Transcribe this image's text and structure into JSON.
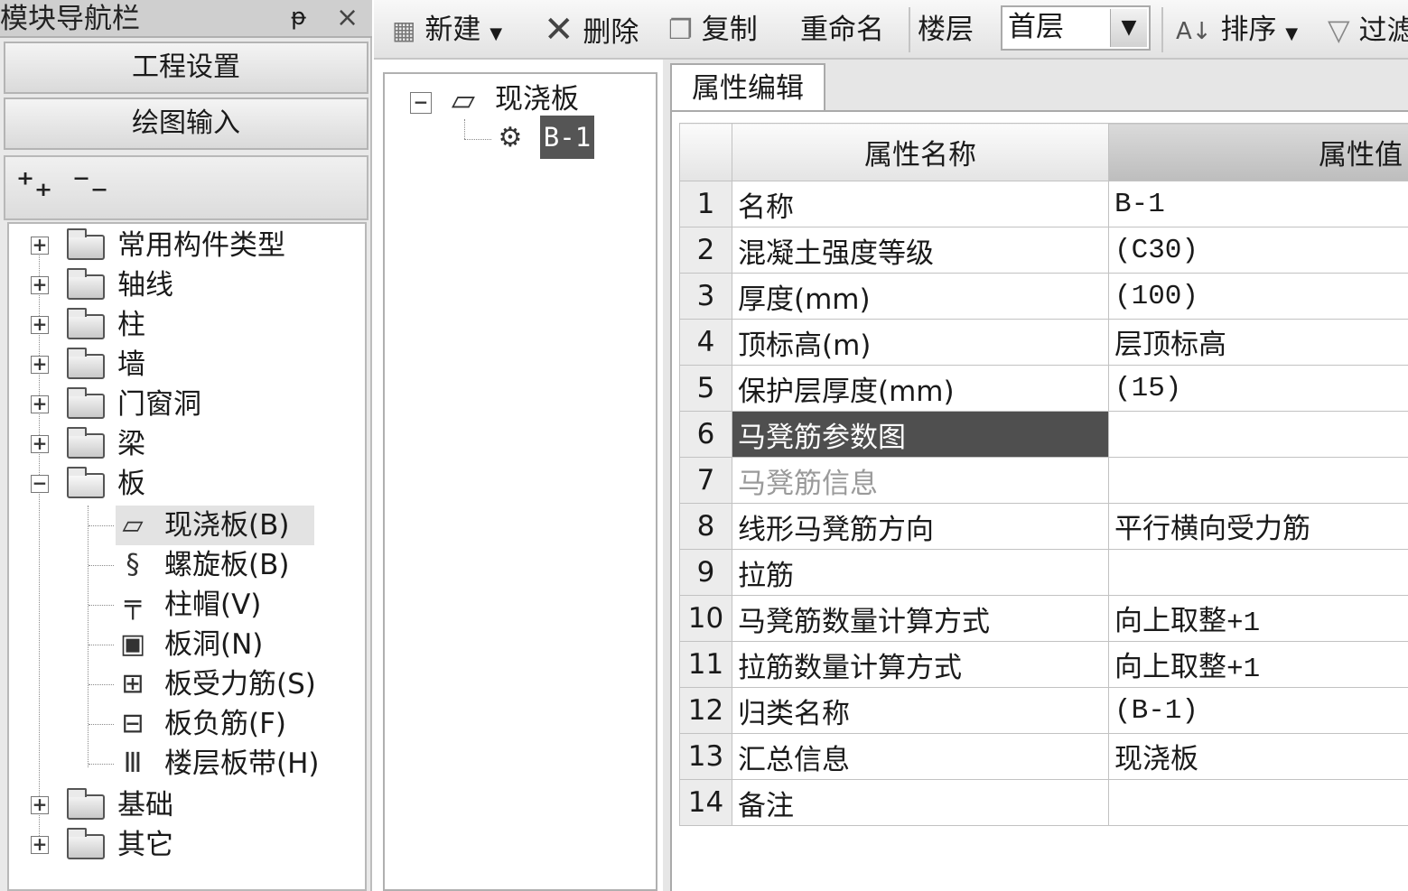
{
  "nav": {
    "title": "模块导航栏",
    "pin_glyph": "ᵽ",
    "close_glyph": "×",
    "buttons": [
      "工程设置",
      "绘图输入"
    ],
    "tree": {
      "categories": [
        "常用构件类型",
        "轴线",
        "柱",
        "墙",
        "门窗洞",
        "梁",
        "板",
        "基础",
        "其它"
      ],
      "expanded": "板",
      "children": [
        "现浇板(B)",
        "螺旋板(B)",
        "柱帽(V)",
        "板洞(N)",
        "板受力筋(S)",
        "板负筋(F)",
        "楼层板带(H)"
      ],
      "selected_child": "现浇板(B)"
    }
  },
  "toolbar": {
    "new": "新建",
    "delete": "删除",
    "copy": "复制",
    "rename": "重命名",
    "floor_label": "楼层",
    "floor_value": "首层",
    "sort": "排序",
    "filter": "过滤"
  },
  "component_tree": {
    "root": "现浇板",
    "item": "B-1"
  },
  "editor": {
    "tab": "属性编辑",
    "col_name": "属性名称",
    "col_value": "属性值",
    "rows": [
      {
        "n": "1",
        "name": "名称",
        "value": "B-1"
      },
      {
        "n": "2",
        "name": "混凝土强度等级",
        "value": "(C30)"
      },
      {
        "n": "3",
        "name": "厚度(mm)",
        "value": "(100)"
      },
      {
        "n": "4",
        "name": "顶标高(m)",
        "value": "层顶标高"
      },
      {
        "n": "5",
        "name": "保护层厚度(mm)",
        "value": "(15)"
      },
      {
        "n": "6",
        "name": "马凳筋参数图",
        "value": ""
      },
      {
        "n": "7",
        "name": "马凳筋信息",
        "value": ""
      },
      {
        "n": "8",
        "name": "线形马凳筋方向",
        "value": "平行横向受力筋"
      },
      {
        "n": "9",
        "name": "拉筋",
        "value": ""
      },
      {
        "n": "10",
        "name": "马凳筋数量计算方式",
        "value": "向上取整+1"
      },
      {
        "n": "11",
        "name": "拉筋数量计算方式",
        "value": "向上取整+1"
      },
      {
        "n": "12",
        "name": "归类名称",
        "value": "(B-1)"
      },
      {
        "n": "13",
        "name": "汇总信息",
        "value": "现浇板"
      },
      {
        "n": "14",
        "name": "备注",
        "value": ""
      }
    ],
    "highlighted_row": "6",
    "dimmed_row": "7"
  }
}
